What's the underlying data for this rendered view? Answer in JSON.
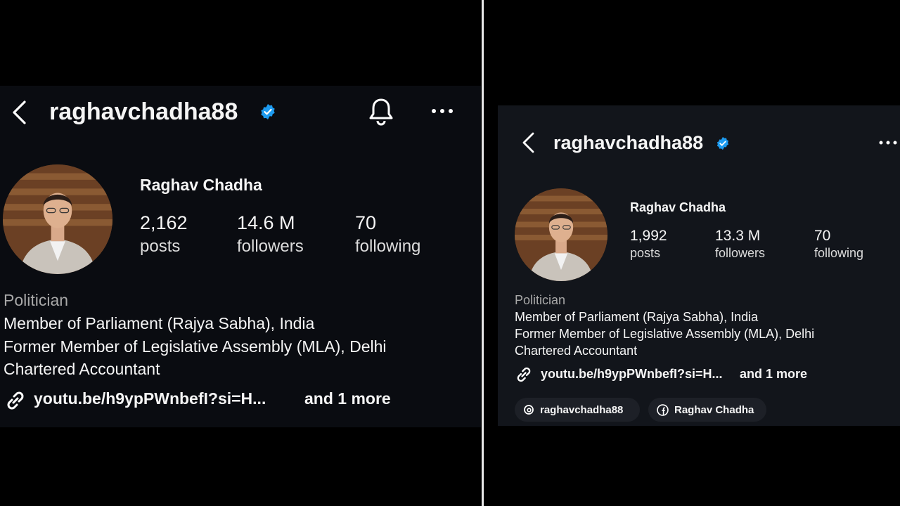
{
  "left": {
    "username": "raghavchadha88",
    "display_name": "Raghav Chadha",
    "stats": [
      {
        "value": "2,162",
        "label": "posts"
      },
      {
        "value": "14.6 M",
        "label": "followers"
      },
      {
        "value": "70",
        "label": "following"
      }
    ],
    "category": "Politician",
    "bio": [
      "Member of Parliament (Rajya Sabha), India",
      "Former Member of Legislative Assembly (MLA), Delhi",
      "Chartered Accountant"
    ],
    "link": "youtu.be/h9ypPWnbefI?si=H...",
    "link_more": "and 1 more"
  },
  "right": {
    "username": "raghavchadha88",
    "display_name": "Raghav Chadha",
    "stats": [
      {
        "value": "1,992",
        "label": "posts"
      },
      {
        "value": "13.3 M",
        "label": "followers"
      },
      {
        "value": "70",
        "label": "following"
      }
    ],
    "category": "Politician",
    "bio": [
      "Member of Parliament (Rajya Sabha), India",
      "Former Member of Legislative Assembly (MLA), Delhi",
      "Chartered Accountant"
    ],
    "link": "youtu.be/h9ypPWnbefI?si=H...",
    "link_more": "and 1 more",
    "chips": [
      {
        "icon": "threads-icon",
        "label": "raghavchadha88"
      },
      {
        "icon": "facebook-icon",
        "label": "Raghav Chadha"
      }
    ]
  },
  "colors": {
    "verified": "#1d9bf0",
    "background": "#000000",
    "panel": "#0b0d12"
  }
}
